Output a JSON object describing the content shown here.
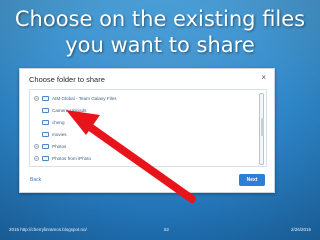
{
  "slide": {
    "title_line1": "Choose on the existing files",
    "title_line2": "you want to share"
  },
  "dialog": {
    "title": "Choose folder to share",
    "close_glyph": "×",
    "folders": [
      {
        "label": "AIM Global - Team Galaxy Files",
        "expandable": true
      },
      {
        "label": "Camera Uploads",
        "expandable": false
      },
      {
        "label": "cheng",
        "expandable": false
      },
      {
        "label": "movies",
        "expandable": false
      },
      {
        "label": "Photos",
        "expandable": true
      },
      {
        "label": "Photos from iPhoto",
        "expandable": true
      }
    ],
    "expander_glyph": "+",
    "back_label": "Back",
    "next_label": "Next"
  },
  "footer": {
    "source": "2015 http://cherrylinramos.blogspot.no/",
    "page": "82",
    "date": "2/26/2015"
  },
  "colors": {
    "background": "#2e86c8",
    "arrow": "#e8141c",
    "next_button": "#2d7ed6"
  },
  "icons": {
    "folder": "folder-icon",
    "close": "close-icon",
    "expander": "expand-icon",
    "arrow": "red-arrow-icon"
  }
}
